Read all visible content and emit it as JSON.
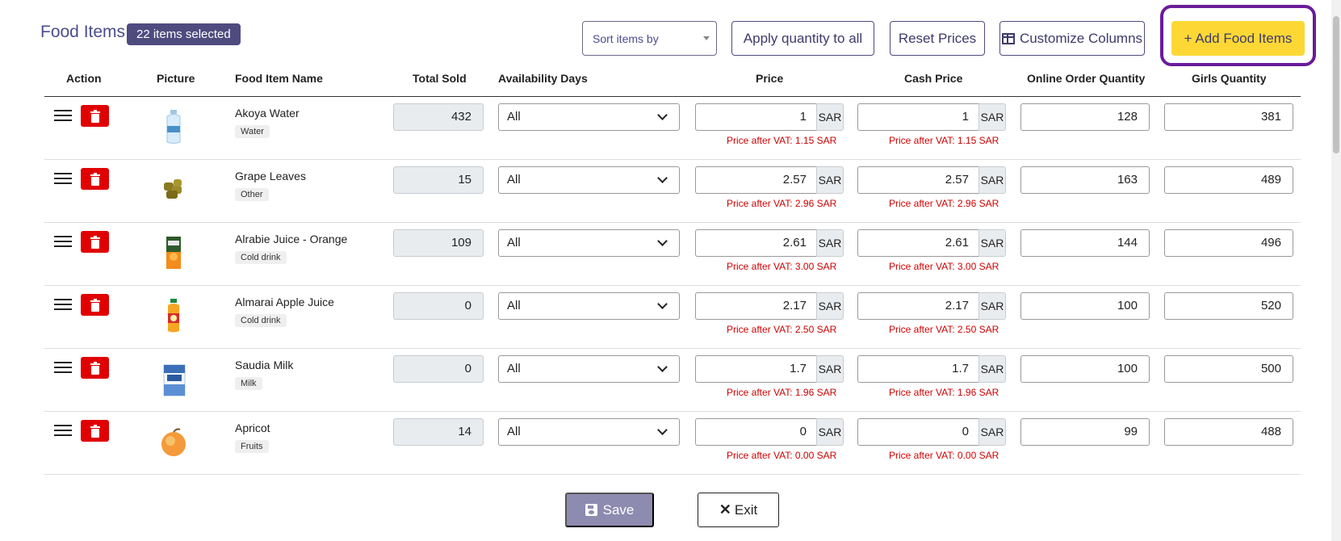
{
  "header": {
    "title": "Food Items",
    "selected_badge": "22 items selected"
  },
  "toolbar": {
    "sort_placeholder": "Sort items by",
    "apply_qty_label": "Apply quantity to all",
    "reset_prices_label": "Reset Prices",
    "customize_columns_label": "Customize Columns",
    "add_food_label": "+ Add Food Items"
  },
  "columns": {
    "action": "Action",
    "picture": "Picture",
    "name": "Food Item Name",
    "total_sold": "Total Sold",
    "availability": "Availability Days",
    "price": "Price",
    "cash_price": "Cash Price",
    "online_qty": "Online Order Quantity",
    "girls_qty": "Girls Quantity"
  },
  "currency": "SAR",
  "rows": [
    {
      "name": "Akoya Water",
      "category": "Water",
      "total_sold": "432",
      "availability": "All",
      "price": "1",
      "price_vat": "Price after VAT: 1.15 SAR",
      "cash_price": "1",
      "cash_vat": "Price after VAT: 1.15 SAR",
      "online_qty": "128",
      "girls_qty": "381",
      "icon": "water-bottle-icon"
    },
    {
      "name": "Grape Leaves",
      "category": "Other",
      "total_sold": "15",
      "availability": "All",
      "price": "2.57",
      "price_vat": "Price after VAT: 2.96 SAR",
      "cash_price": "2.57",
      "cash_vat": "Price after VAT: 2.96 SAR",
      "online_qty": "163",
      "girls_qty": "489",
      "icon": "grape-leaves-icon"
    },
    {
      "name": "Alrabie Juice - Orange",
      "category": "Cold drink",
      "total_sold": "109",
      "availability": "All",
      "price": "2.61",
      "price_vat": "Price after VAT: 3.00 SAR",
      "cash_price": "2.61",
      "cash_vat": "Price after VAT: 3.00 SAR",
      "online_qty": "144",
      "girls_qty": "496",
      "icon": "juice-box-icon"
    },
    {
      "name": "Almarai Apple Juice",
      "category": "Cold drink",
      "total_sold": "0",
      "availability": "All",
      "price": "2.17",
      "price_vat": "Price after VAT: 2.50 SAR",
      "cash_price": "2.17",
      "cash_vat": "Price after VAT: 2.50 SAR",
      "online_qty": "100",
      "girls_qty": "520",
      "icon": "juice-bottle-icon"
    },
    {
      "name": "Saudia Milk",
      "category": "Milk",
      "total_sold": "0",
      "availability": "All",
      "price": "1.7",
      "price_vat": "Price after VAT: 1.96 SAR",
      "cash_price": "1.7",
      "cash_vat": "Price after VAT: 1.96 SAR",
      "online_qty": "100",
      "girls_qty": "500",
      "icon": "milk-carton-icon"
    },
    {
      "name": "Apricot",
      "category": "Fruits",
      "total_sold": "14",
      "availability": "All",
      "price": "0",
      "price_vat": "Price after VAT: 0.00 SAR",
      "cash_price": "0",
      "cash_vat": "Price after VAT: 0.00 SAR",
      "online_qty": "99",
      "girls_qty": "488",
      "icon": "apricot-icon"
    }
  ],
  "footer": {
    "save_label": "Save",
    "exit_label": "Exit"
  },
  "colors": {
    "accent": "#4f4b7f",
    "add_button": "#fdd835",
    "delete": "#e00000",
    "vat_text": "#d00000",
    "highlight": "#6a1b9a"
  }
}
